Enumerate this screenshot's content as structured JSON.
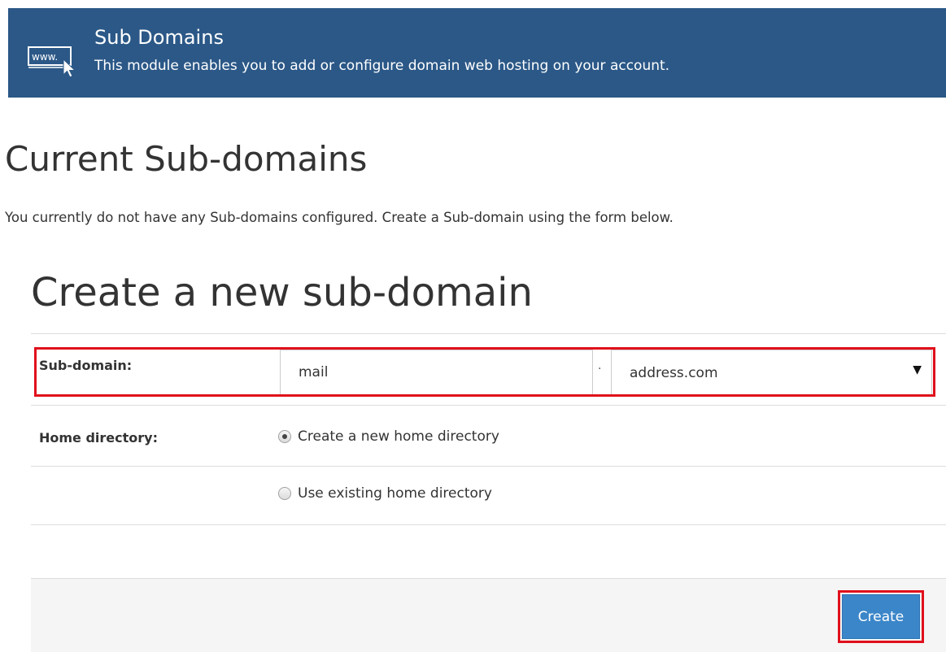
{
  "module": {
    "title": "Sub Domains",
    "description": "This module enables you to add or configure domain web hosting on your account.",
    "icon": "www-cursor-icon",
    "icon_text": "www."
  },
  "current": {
    "heading": "Current Sub-domains",
    "empty_message": "You currently do not have any Sub-domains configured. Create a Sub-domain using the form below."
  },
  "create": {
    "heading": "Create a new sub-domain",
    "subdomain_label": "Sub-domain:",
    "subdomain_value": "mail",
    "separator": ".",
    "domain_selected": "address.com",
    "home_dir_label": "Home directory:",
    "radio_options": [
      {
        "label": "Create a new home directory",
        "checked": true
      },
      {
        "label": "Use existing home directory",
        "checked": false
      }
    ],
    "submit_label": "Create"
  },
  "colors": {
    "header_bg": "#2b5887",
    "button_bg": "#3b86c9",
    "highlight": "#e0101b"
  }
}
